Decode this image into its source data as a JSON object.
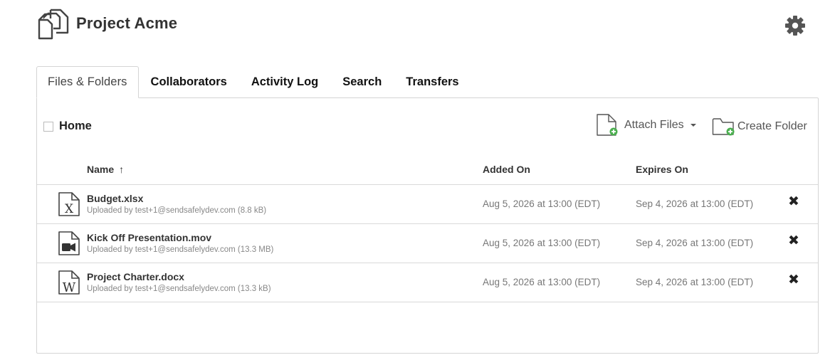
{
  "project": {
    "title": "Project Acme"
  },
  "tabs": [
    {
      "label": "Files & Folders",
      "active": true
    },
    {
      "label": "Collaborators"
    },
    {
      "label": "Activity Log"
    },
    {
      "label": "Search"
    },
    {
      "label": "Transfers"
    }
  ],
  "breadcrumb": {
    "label": "Home"
  },
  "actions": {
    "attach_label": "Attach Files",
    "create_label": "Create Folder"
  },
  "columns": {
    "name": "Name",
    "sort_glyph": "↑",
    "added": "Added On",
    "expires": "Expires On"
  },
  "files": [
    {
      "icon": "excel-file-icon",
      "name": "Budget.xlsx",
      "subtitle": "Uploaded by test+1@sendsafelydev.com (8.8 kB)",
      "added": "Aug 5, 2026 at 13:00 (EDT)",
      "expires": "Sep 4, 2026 at 13:00 (EDT)"
    },
    {
      "icon": "video-file-icon",
      "name": "Kick Off Presentation.mov",
      "subtitle": "Uploaded by test+1@sendsafelydev.com (13.3 MB)",
      "added": "Aug 5, 2026 at 13:00 (EDT)",
      "expires": "Sep 4, 2026 at 13:00 (EDT)"
    },
    {
      "icon": "word-file-icon",
      "name": "Project Charter.docx",
      "subtitle": "Uploaded by test+1@sendsafelydev.com (13.3 kB)",
      "added": "Aug 5, 2026 at 13:00 (EDT)",
      "expires": "Sep 4, 2026 at 13:00 (EDT)"
    }
  ],
  "delete_glyph": "✖",
  "colors": {
    "accent_green": "#4caf50",
    "border": "#d4d4d4"
  }
}
